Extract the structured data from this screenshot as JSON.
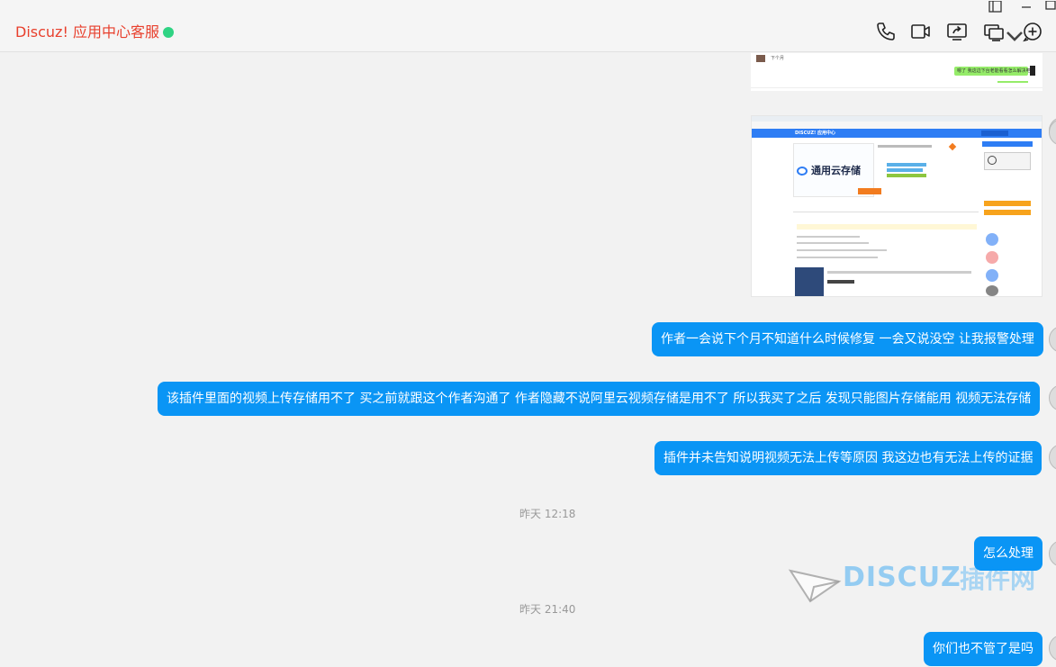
{
  "header": {
    "title": "Discuz! 应用中心客服",
    "status_color": "#2fd383",
    "icons": [
      "phone-icon",
      "video-call-icon",
      "screen-share-icon",
      "remote-desktop-icon",
      "add-chat-icon"
    ]
  },
  "image1": {
    "name_text": "下个月",
    "reply_text": "嗯了 我这边下台老能看看怎么解决吧"
  },
  "image2": {
    "brand": "DISCUZ! 应用中心",
    "product_name": "通用云存储"
  },
  "messages": [
    {
      "text": "作者一会说下个月不知道什么时候修复 一会又说没空 让我报警处理"
    },
    {
      "text": "该插件里面的视频上传存储用不了 买之前就跟这个作者沟通了 作者隐藏不说阿里云视频存储是用不了 所以我买了之后 发现只能图片存储能用 视频无法存储"
    },
    {
      "text": "插件并未告知说明视频无法上传等原因 我这边也有无法上传的证据"
    },
    {
      "timestamp": "昨天 12:18"
    },
    {
      "text": "怎么处理"
    },
    {
      "timestamp": "昨天 21:40"
    },
    {
      "text": "你们也不管了是吗"
    }
  ],
  "watermark": {
    "logo": "DISCUZ",
    "site": "插件网"
  },
  "colors": {
    "bubble": "#0a95f5",
    "title": "#e8402d",
    "background": "#f2f2f2"
  }
}
